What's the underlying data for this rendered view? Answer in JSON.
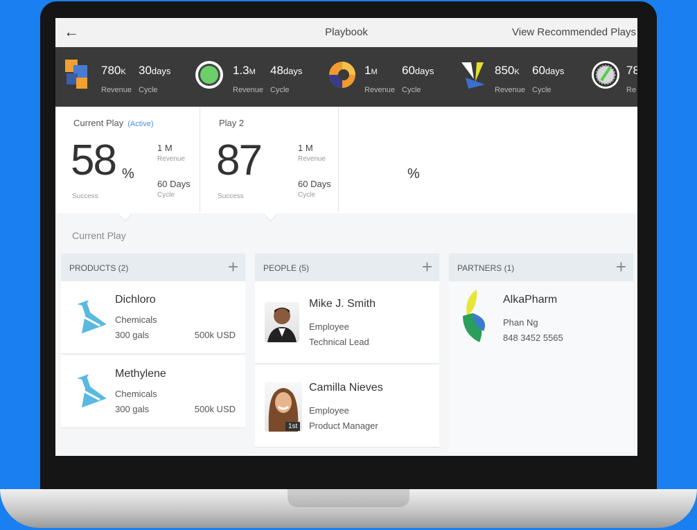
{
  "header": {
    "title": "Playbook",
    "view_recommended": "View Recommended Plays"
  },
  "stats": [
    {
      "icon": "squares-logo-icon",
      "value": "780",
      "value_unit": "K",
      "value_label": "Revenue",
      "cycle": "30",
      "cycle_unit": "days",
      "cycle_label": "Cycle"
    },
    {
      "icon": "green-circle-logo-icon",
      "value": "1.3",
      "value_unit": "M",
      "value_label": "Revenue",
      "cycle": "48",
      "cycle_unit": "days",
      "cycle_label": "Cycle"
    },
    {
      "icon": "swirl-logo-icon",
      "value": "1",
      "value_unit": "M",
      "value_label": "Revenue",
      "cycle": "60",
      "cycle_unit": "days",
      "cycle_label": "Cycle"
    },
    {
      "icon": "v-logo-icon",
      "value": "850",
      "value_unit": "K",
      "value_label": "Revenue",
      "cycle": "60",
      "cycle_unit": "days",
      "cycle_label": "Cycle"
    },
    {
      "icon": "gear-circle-logo-icon",
      "value": "78",
      "value_unit": "",
      "value_label": "Re",
      "cycle": "",
      "cycle_unit": "",
      "cycle_label": ""
    }
  ],
  "plays": [
    {
      "title": "Current Play",
      "status": "(Active)",
      "success": "58",
      "success_unit": "%",
      "success_label": "Success",
      "revenue": "1 M",
      "revenue_label": "Revenue",
      "cycle": "60 Days",
      "cycle_label": "Cycle"
    },
    {
      "title": "Play 2",
      "status": "",
      "success": "87",
      "success_unit": "%",
      "success_label": "Success",
      "revenue": "1 M",
      "revenue_label": "Revenue",
      "cycle": "60 Days",
      "cycle_label": "Cycle"
    }
  ],
  "section_label": "Current Play",
  "products": {
    "header": "PRODUCTS (2)",
    "items": [
      {
        "name": "Dichloro",
        "category": "Chemicals",
        "quantity": "300 gals",
        "price": "500k USD"
      },
      {
        "name": "Methylene",
        "category": "Chemicals",
        "quantity": "300 gals",
        "price": "500k USD"
      }
    ]
  },
  "people": {
    "header": "PEOPLE (5)",
    "items": [
      {
        "name": "Mike J. Smith",
        "type": "Employee",
        "role": "Technical Lead",
        "badge": ""
      },
      {
        "name": "Camilla Nieves",
        "type": "Employee",
        "role": "Product Manager",
        "badge": "1st"
      }
    ]
  },
  "partners": {
    "header": "PARTNERS (1)",
    "items": [
      {
        "name": "AlkaPharm",
        "contact": "Phan Ng",
        "phone": "848 3452 5565"
      }
    ]
  },
  "plus_glyph": "+",
  "back_glyph": "←"
}
